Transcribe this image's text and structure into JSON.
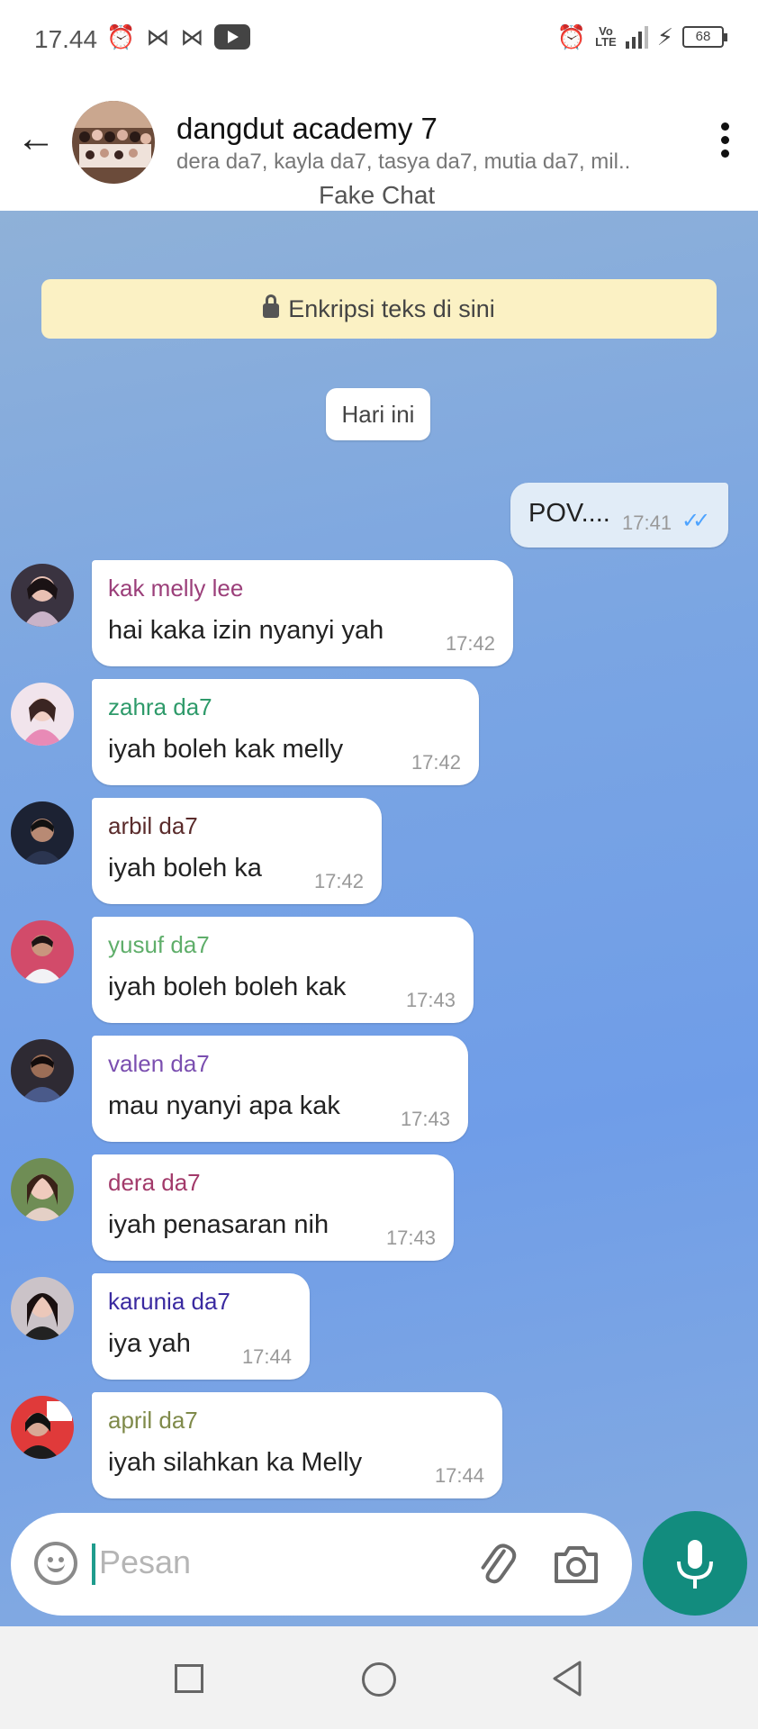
{
  "status_bar": {
    "time": "17.44",
    "battery": "68",
    "volte_line1": "Vo",
    "volte_line2": "LTE"
  },
  "header": {
    "title": "dangdut academy 7",
    "members": "dera da7, kayla da7, tasya da7, mutia da7, mil..",
    "subtitle": "Fake Chat"
  },
  "chat": {
    "encryption_banner": "Enkripsi teks di sini",
    "day_chip": "Hari ini",
    "outgoing": {
      "text": "POV....",
      "time": "17:41"
    },
    "messages": [
      {
        "sender": "kak melly lee",
        "text": "hai kaka izin nyanyi yah",
        "time": "17:42",
        "color": "#9b3f7a"
      },
      {
        "sender": "zahra da7",
        "text": "iyah boleh kak melly",
        "time": "17:42",
        "color": "#2e9a6a"
      },
      {
        "sender": "arbil da7",
        "text": "iyah boleh ka",
        "time": "17:42",
        "color": "#5a2b2b"
      },
      {
        "sender": "yusuf da7",
        "text": "iyah boleh boleh kak",
        "time": "17:43",
        "color": "#5fae6a"
      },
      {
        "sender": "valen da7",
        "text": "mau nyanyi apa kak",
        "time": "17:43",
        "color": "#7b4fb0"
      },
      {
        "sender": "dera da7",
        "text": "iyah penasaran nih",
        "time": "17:43",
        "color": "#a23a6a"
      },
      {
        "sender": "karunia da7",
        "text": "iya yah",
        "time": "17:44",
        "color": "#3a2aa0"
      },
      {
        "sender": "april da7",
        "text": "iyah silahkan ka Melly",
        "time": "17:44",
        "color": "#7f8a4a"
      }
    ]
  },
  "input": {
    "placeholder": "Pesan"
  },
  "colors": {
    "accent": "#128c7e",
    "tick": "#4da3ff",
    "banner": "#fbf1c4"
  }
}
